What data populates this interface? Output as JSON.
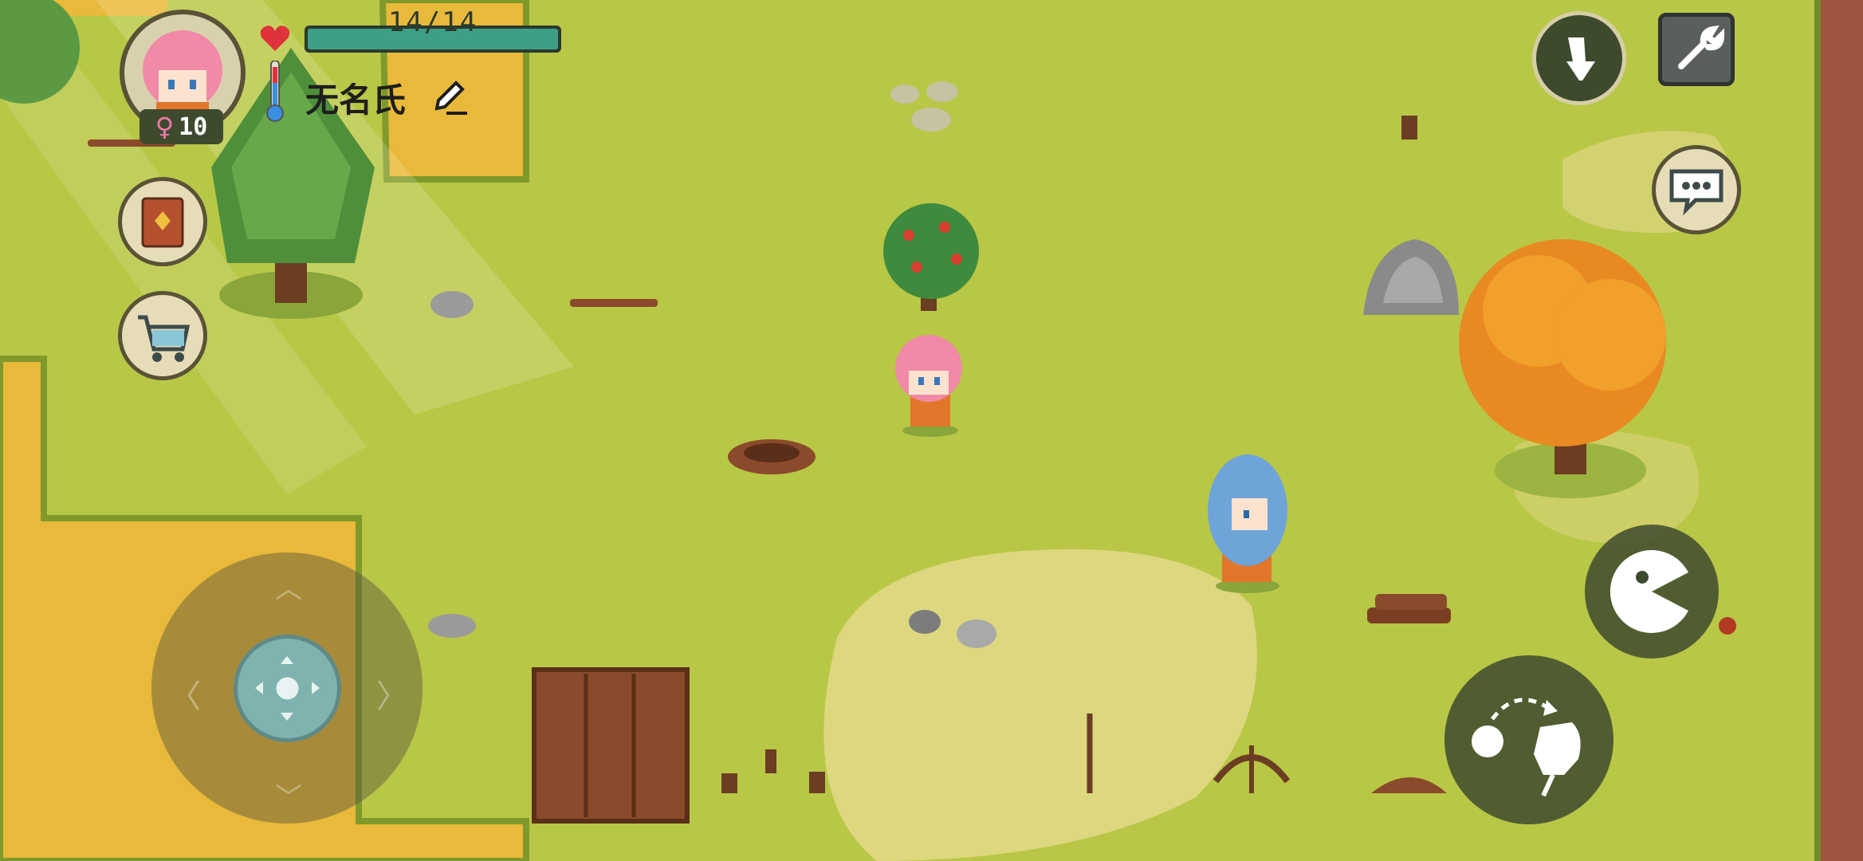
{
  "hud": {
    "health_text": "14/14",
    "health_fraction": 1.0,
    "player_name": "无名氏",
    "level": "10",
    "gender_symbol": "♀"
  },
  "colors": {
    "grass": "#b8c746",
    "dry_patch": "#e8b93a",
    "sand_patch": "#e3d98a",
    "cliff": "#a0553f",
    "health_bar": "#3f9e86",
    "hud_dark": "#3e4a2e"
  },
  "icons": {
    "heart": "heart-icon",
    "thermometer": "thermometer-icon",
    "edit": "pencil-icon",
    "journal": "book-icon",
    "shop": "cart-icon",
    "attack": "sword-icon",
    "settings": "wrench-icon",
    "chat": "chat-icon",
    "eat": "pacman-icon",
    "throw": "throw-hand-icon",
    "dpad": "dpad-icon"
  }
}
